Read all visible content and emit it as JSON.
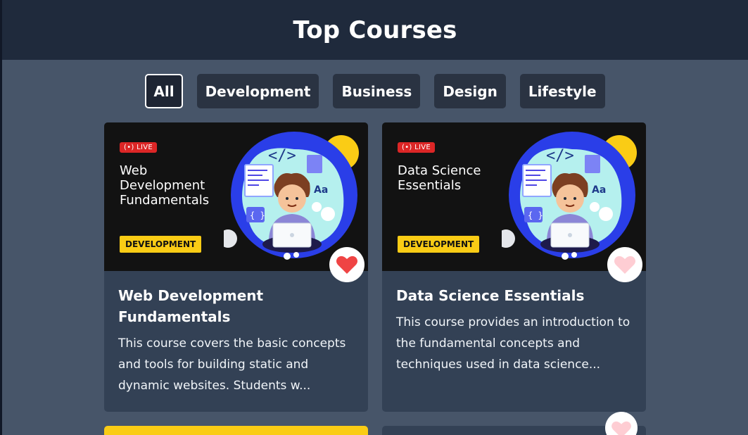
{
  "header": {
    "title": "Top Courses"
  },
  "filters": [
    {
      "label": "All",
      "active": true
    },
    {
      "label": "Development",
      "active": false
    },
    {
      "label": "Business",
      "active": false
    },
    {
      "label": "Design",
      "active": false
    },
    {
      "label": "Lifestyle",
      "active": false
    }
  ],
  "courses": [
    {
      "live_label": "LIVE",
      "thumb_title": "Web Development Fundamentals",
      "category_tag": "DEVELOPMENT",
      "title": "Web Development Fundamentals",
      "description": "This course covers the basic concepts and tools for building static and dynamic websites. Students w...",
      "liked": true
    },
    {
      "live_label": "LIVE",
      "thumb_title": "Data Science Essentials",
      "category_tag": "DEVELOPMENT",
      "title": "Data Science Essentials",
      "description": "This course provides an introduction to the fundamental concepts and techniques used in data science...",
      "liked": false
    }
  ],
  "colors": {
    "header_bg": "#1f2a3c",
    "page_bg": "#475569",
    "card_bg": "#334155",
    "chip_bg": "#2a3342",
    "tag_yellow": "#facc15",
    "live_red": "#dc2626",
    "heart_liked": "#ef4444",
    "heart_unliked": "#fecdd3"
  }
}
